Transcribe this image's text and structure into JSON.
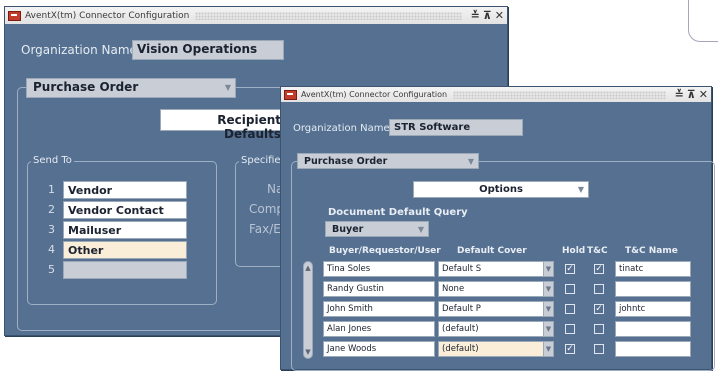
{
  "win1": {
    "title": "AventX(tm) Connector Configuration",
    "org_label": "Organization Name",
    "org_value": "Vision Operations",
    "doc_type": "Purchase Order",
    "recipient_btn": "Recipient Defaults",
    "send_to_title": "Send To",
    "send_to": [
      {
        "num": "1",
        "value": "Vendor"
      },
      {
        "num": "2",
        "value": "Vendor Contact"
      },
      {
        "num": "3",
        "value": "Mailuser"
      },
      {
        "num": "4",
        "value": "Other"
      },
      {
        "num": "5",
        "value": ""
      }
    ],
    "specified_title": "Specifiec",
    "spec_labels": [
      "Na",
      "Comp",
      "Fax/E"
    ]
  },
  "win2": {
    "title": "AventX(tm) Connector Configuration",
    "org_label": "Organization Name",
    "org_value": "STR Software",
    "doc_type": "Purchase Order",
    "options": "Options",
    "ddq_label": "Document Default Query",
    "ddq_value": "Buyer",
    "headers": {
      "user": "Buyer/Requestor/User",
      "cover": "Default Cover",
      "hold": "Hold",
      "tc": "T&C",
      "tcname": "T&C Name"
    },
    "rows": [
      {
        "user": "Tina Soles",
        "cover": "Default S",
        "hold": true,
        "tc": true,
        "tcname": "tinatc"
      },
      {
        "user": "Randy Gustin",
        "cover": "None",
        "hold": false,
        "tc": false,
        "tcname": ""
      },
      {
        "user": "John Smith",
        "cover": "Default P",
        "hold": false,
        "tc": true,
        "tcname": "johntc"
      },
      {
        "user": "Alan Jones",
        "cover": "(default)",
        "hold": false,
        "tc": false,
        "tcname": ""
      },
      {
        "user": "Jane Woods",
        "cover": "(default)",
        "hold": true,
        "tc": false,
        "tcname": ""
      }
    ]
  },
  "colors": {
    "window_bg": "#557090",
    "field_tan": "#fbeed8",
    "field_ro": "#c8cdd6"
  }
}
